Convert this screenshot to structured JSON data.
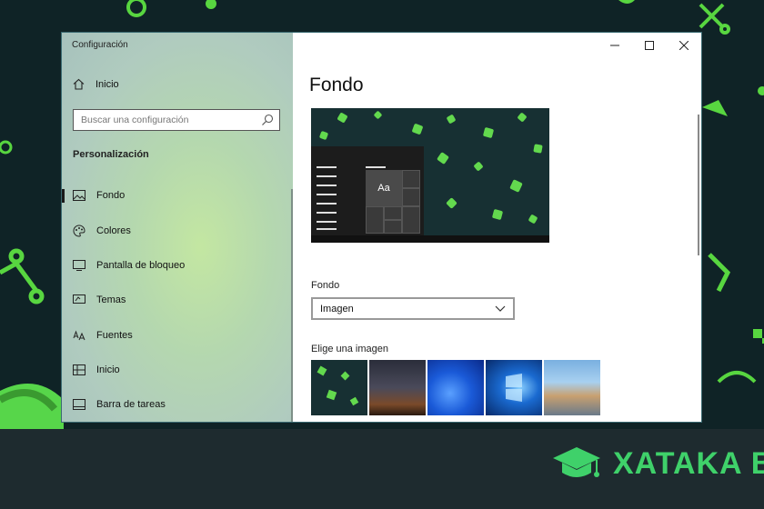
{
  "window": {
    "title": "Configuración"
  },
  "sidebar": {
    "home_label": "Inicio",
    "search_placeholder": "Buscar una configuración",
    "section_title": "Personalización",
    "items": [
      {
        "label": "Fondo",
        "icon": "picture-icon",
        "selected": true
      },
      {
        "label": "Colores",
        "icon": "palette-icon",
        "selected": false
      },
      {
        "label": "Pantalla de bloqueo",
        "icon": "lock-screen-icon",
        "selected": false
      },
      {
        "label": "Temas",
        "icon": "themes-icon",
        "selected": false
      },
      {
        "label": "Fuentes",
        "icon": "fonts-icon",
        "selected": false
      },
      {
        "label": "Inicio",
        "icon": "start-menu-icon",
        "selected": false
      },
      {
        "label": "Barra de tareas",
        "icon": "taskbar-icon",
        "selected": false
      }
    ]
  },
  "content": {
    "title": "Fondo",
    "preview_tile_label": "Aa",
    "background_label": "Fondo",
    "background_value": "Imagen",
    "choose_image_label": "Elige una imagen"
  },
  "brand": {
    "text": "XATAKA BA",
    "color": "#3fd16a"
  },
  "colors": {
    "accent_green": "#63d94e",
    "desktop_bg": "#0f2326"
  }
}
